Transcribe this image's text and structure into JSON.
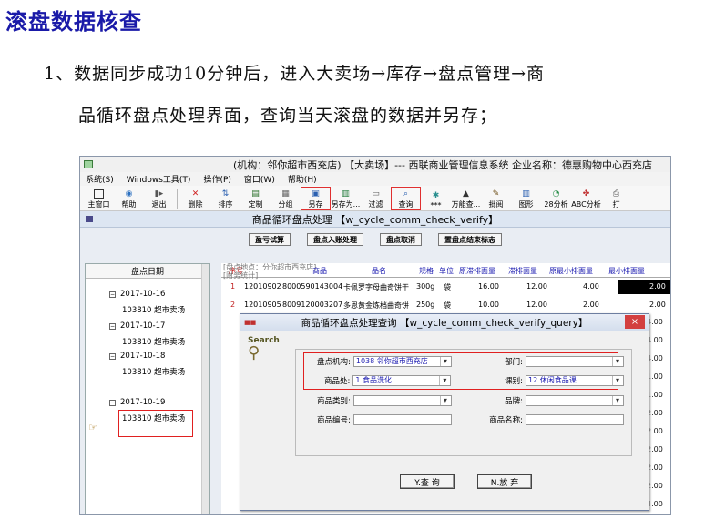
{
  "doc": {
    "heading": "滚盘数据核查",
    "line1": "1、数据同步成功10分钟后，进入大卖场→库存→盘点管理→商",
    "line2": "品循环盘点处理界面，查询当天滚盘的数据并另存；"
  },
  "app": {
    "title": "(机构：邻你超市西充店) 【大卖场】--- 西联商业管理信息系统  企业名称：德惠购物中心西充店",
    "menu": [
      "系统(S)",
      "Windows工具(T)",
      "操作(P)",
      "窗口(W)",
      "帮助(H)"
    ],
    "toolbar": [
      {
        "label": "主窗口",
        "icon": "window-icon"
      },
      {
        "label": "帮助",
        "icon": "help-icon"
      },
      {
        "label": "退出",
        "icon": "exit-icon"
      },
      {
        "label": "删除",
        "icon": "delete-icon"
      },
      {
        "label": "排序",
        "icon": "sort-icon"
      },
      {
        "label": "定制",
        "icon": "custom-icon"
      },
      {
        "label": "分组",
        "icon": "group-icon"
      },
      {
        "label": "另存",
        "icon": "save-as-icon"
      },
      {
        "label": "另存为...",
        "icon": "save-as-file-icon"
      },
      {
        "label": "过滤",
        "icon": "filter-icon"
      },
      {
        "label": "查询",
        "icon": "search-icon"
      },
      {
        "label": "***",
        "icon": "star-icon"
      },
      {
        "label": "万能查...",
        "icon": "universal-search-icon"
      },
      {
        "label": "批阅",
        "icon": "review-icon"
      },
      {
        "label": "图形",
        "icon": "chart-icon"
      },
      {
        "label": "28分析",
        "icon": "analysis-icon"
      },
      {
        "label": "ABC分析",
        "icon": "abc-icon"
      },
      {
        "label": "打",
        "icon": "print-icon"
      }
    ]
  },
  "window": {
    "title": "商品循环盘点处理 【w_cycle_comm_check_verify】",
    "actions": [
      "盈亏试算",
      "盘点入账处理",
      "盘点取消",
      "置盘点结束标志"
    ]
  },
  "tree": {
    "header": "盘点日期",
    "dates": [
      {
        "date": "2017-10-16",
        "store": "103810  超市卖场"
      },
      {
        "date": "2017-10-17",
        "store": "103810  超市卖场"
      },
      {
        "date": "2017-10-18",
        "store": "103810  超市卖场"
      },
      {
        "date": "2017-10-19",
        "store": "103810  超市卖场"
      }
    ]
  },
  "grid": {
    "overlay1": "[盘点地点：分你超市西充店]",
    "overlay2": "[财务统计]",
    "headers": [
      "序号",
      "商品",
      "品名",
      "规格",
      "单位",
      "原滞排面量",
      "滞排面量",
      "原最小排面量",
      "最小排面量"
    ],
    "rows": [
      {
        "no": "1",
        "code": "12010902",
        "barcode": "8000590143004",
        "name": "卡佩罗字母曲奇饼干",
        "spec": "300g",
        "unit": "袋",
        "orig": "16.00",
        "face": "12.00",
        "origMin": "4.00",
        "min": "2.00"
      },
      {
        "no": "2",
        "code": "12010905",
        "barcode": "8009120003207",
        "name": "多恩黄金炼档曲奇饼",
        "spec": "250g",
        "unit": "袋",
        "orig": "10.00",
        "face": "12.00",
        "origMin": "2.00",
        "min": "2.00"
      }
    ],
    "rightColumn": [
      "4.00",
      "4.00",
      "4.00",
      "1.00",
      "1.00",
      "2.00",
      "2.00",
      "2.00",
      "2.00",
      "2.00",
      "4.00"
    ]
  },
  "dialog": {
    "title": "商品循环盘点处理查询 【w_cycle_comm_check_verify_query】",
    "badge": "Search",
    "fields": {
      "org_label": "盘点机构:",
      "org_value": "1038  邻你超市西充店",
      "dept_label": "部门:",
      "dept_value": "",
      "div_label": "商品处:",
      "div_value": "1  食品洗化",
      "section_label": "课别:",
      "section_value": "12  休闲食品课",
      "cat_label": "商品类别:",
      "cat_value": "",
      "brand_label": "品牌:",
      "brand_value": "",
      "code_label": "商品编号:",
      "code_value": "",
      "name_label": "商品名称:",
      "name_value": ""
    },
    "query_button": "Y.查 询",
    "cancel_button": "N.放 弃",
    "close": "×"
  }
}
